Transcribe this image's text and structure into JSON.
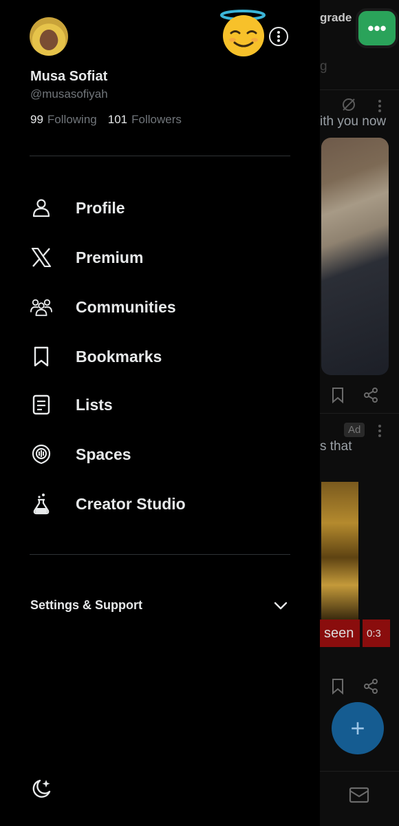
{
  "profile": {
    "name": "Musa Sofiat",
    "handle": "@musasofiyah",
    "following_count": "99",
    "following_label": "Following",
    "followers_count": "101",
    "followers_label": "Followers"
  },
  "menu": [
    {
      "label": "Profile",
      "icon": "person-icon"
    },
    {
      "label": "Premium",
      "icon": "x-logo-icon"
    },
    {
      "label": "Communities",
      "icon": "communities-icon"
    },
    {
      "label": "Bookmarks",
      "icon": "bookmark-icon"
    },
    {
      "label": "Lists",
      "icon": "list-icon"
    },
    {
      "label": "Spaces",
      "icon": "spaces-icon"
    },
    {
      "label": "Creator Studio",
      "icon": "flask-icon"
    }
  ],
  "settings": {
    "label": "Settings & Support"
  },
  "feed": {
    "upgrade_fragment": "grade",
    "search_fragment": "g",
    "post1_fragment": "ith you now",
    "post2_fragment": "s that",
    "ad_badge": "Ad",
    "video_text": "seen",
    "video_time": "0:3"
  },
  "colors": {
    "background": "#000000",
    "text_primary": "#e7e9ea",
    "text_secondary": "#71767b",
    "divider": "#2f3336",
    "fab": "#155c91"
  }
}
